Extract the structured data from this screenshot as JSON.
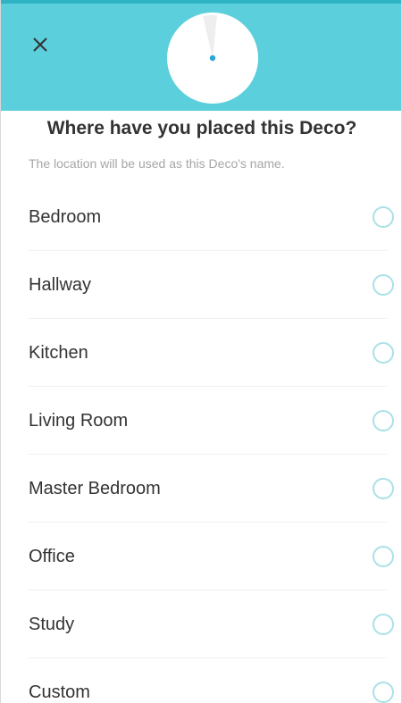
{
  "header": {
    "close_icon": "close-icon",
    "accent_color": "#5bcfdc"
  },
  "title": "Where have you placed this Deco?",
  "subtitle": "The location will be used as this Deco's name.",
  "locations": [
    {
      "label": "Bedroom"
    },
    {
      "label": "Hallway"
    },
    {
      "label": "Kitchen"
    },
    {
      "label": "Living Room"
    },
    {
      "label": "Master Bedroom"
    },
    {
      "label": "Office"
    },
    {
      "label": "Study"
    },
    {
      "label": "Custom"
    }
  ]
}
